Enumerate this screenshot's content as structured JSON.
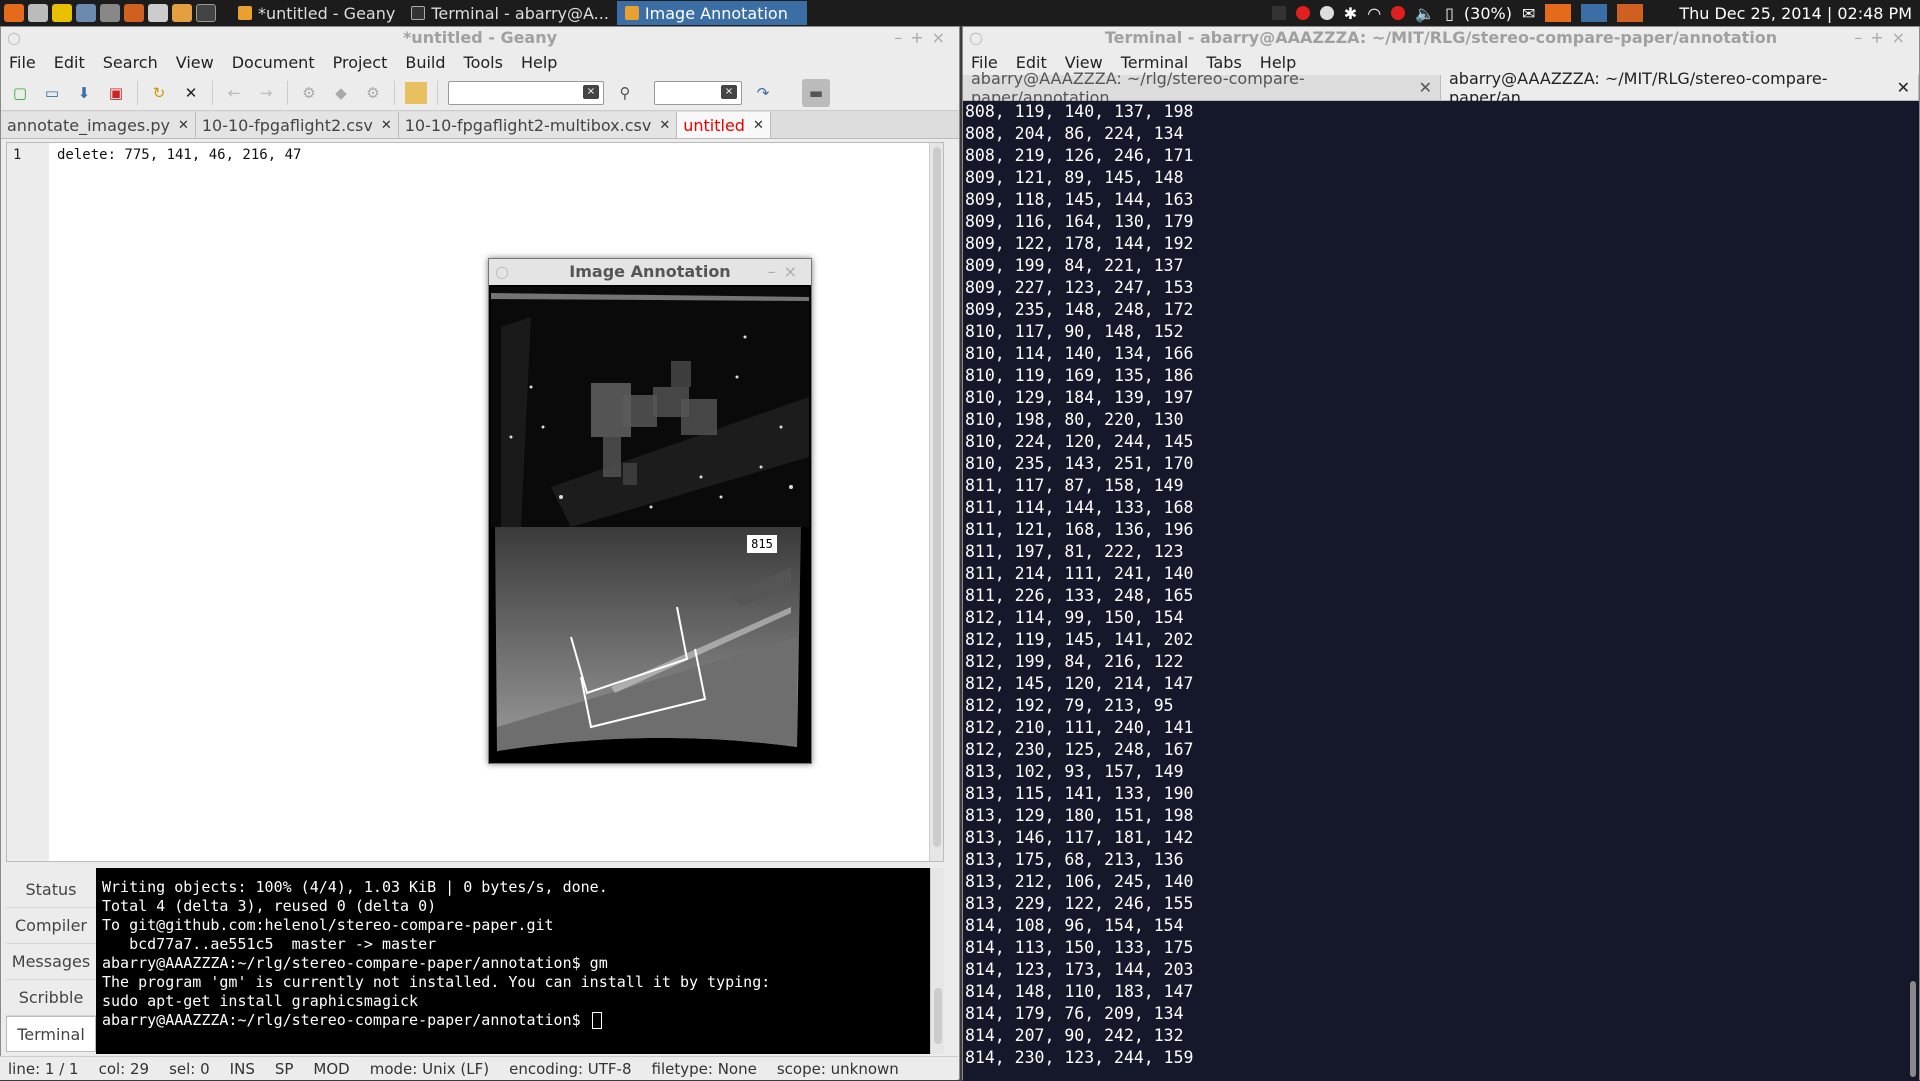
{
  "taskbar": {
    "tasks": [
      {
        "label": "*untitled - Geany"
      },
      {
        "label": "Terminal - abarry@A..."
      },
      {
        "label": "Image Annotation"
      }
    ],
    "battery": "(30%)",
    "clock": "Thu Dec 25, 2014 | 02:48 PM"
  },
  "geany": {
    "title": "*untitled - Geany",
    "menu": [
      "File",
      "Edit",
      "Search",
      "View",
      "Document",
      "Project",
      "Build",
      "Tools",
      "Help"
    ],
    "tabs": [
      {
        "label": "annotate_images.py"
      },
      {
        "label": "10-10-fpgaflight2.csv"
      },
      {
        "label": "10-10-fpgaflight2-multibox.csv"
      },
      {
        "label": "untitled"
      }
    ],
    "editor": {
      "line_number": "1",
      "line_text": "delete: 775, 141, 46, 216, 47"
    },
    "msg_tabs": [
      "Status",
      "Compiler",
      "Messages",
      "Scribble",
      "Terminal"
    ],
    "terminal_lines": [
      "Writing objects: 100% (4/4), 1.03 KiB | 0 bytes/s, done.",
      "Total 4 (delta 3), reused 0 (delta 0)",
      "To git@github.com:helenol/stereo-compare-paper.git",
      "   bcd77a7..ae551c5  master -> master",
      "abarry@AAAZZZA:~/rlg/stereo-compare-paper/annotation$ gm",
      "The program 'gm' is currently not installed. You can install it by typing:",
      "sudo apt-get install graphicsmagick",
      "abarry@AAAZZZA:~/rlg/stereo-compare-paper/annotation$ "
    ],
    "status": {
      "line": "line: 1 / 1",
      "col": "col: 29",
      "sel": "sel: 0",
      "ins": "INS",
      "sp": "SP",
      "mod": "MOD",
      "mode": "mode: Unix (LF)",
      "encoding": "encoding: UTF-8",
      "filetype": "filetype: None",
      "scope": "scope: unknown"
    }
  },
  "annotation": {
    "title": "Image Annotation",
    "frame_label": "815"
  },
  "terminal": {
    "title": "Terminal - abarry@AAAZZZA: ~/MIT/RLG/stereo-compare-paper/annotation",
    "menu": [
      "File",
      "Edit",
      "View",
      "Terminal",
      "Tabs",
      "Help"
    ],
    "tabs": [
      {
        "label": "abarry@AAAZZZA: ~/rlg/stereo-compare-paper/annotation"
      },
      {
        "label": "abarry@AAAZZZA: ~/MIT/RLG/stereo-compare-paper/an..."
      }
    ],
    "lines": [
      "808, 119, 140, 137, 198",
      "808, 204, 86, 224, 134",
      "808, 219, 126, 246, 171",
      "809, 121, 89, 145, 148",
      "809, 118, 145, 144, 163",
      "809, 116, 164, 130, 179",
      "809, 122, 178, 144, 192",
      "809, 199, 84, 221, 137",
      "809, 227, 123, 247, 153",
      "809, 235, 148, 248, 172",
      "810, 117, 90, 148, 152",
      "810, 114, 140, 134, 166",
      "810, 119, 169, 135, 186",
      "810, 129, 184, 139, 197",
      "810, 198, 80, 220, 130",
      "810, 224, 120, 244, 145",
      "810, 235, 143, 251, 170",
      "811, 117, 87, 158, 149",
      "811, 114, 144, 133, 168",
      "811, 121, 168, 136, 196",
      "811, 197, 81, 222, 123",
      "811, 214, 111, 241, 140",
      "811, 226, 133, 248, 165",
      "812, 114, 99, 150, 154",
      "812, 119, 145, 141, 202",
      "812, 199, 84, 216, 122",
      "812, 145, 120, 214, 147",
      "812, 192, 79, 213, 95",
      "812, 210, 111, 240, 141",
      "812, 230, 125, 248, 167",
      "813, 102, 93, 157, 149",
      "813, 115, 141, 133, 190",
      "813, 129, 180, 151, 198",
      "813, 146, 117, 181, 142",
      "813, 175, 68, 213, 136",
      "813, 212, 106, 245, 140",
      "813, 229, 122, 246, 155",
      "814, 108, 96, 154, 154",
      "814, 113, 150, 133, 175",
      "814, 123, 173, 144, 203",
      "814, 148, 110, 183, 147",
      "814, 179, 76, 209, 134",
      "814, 207, 90, 242, 132",
      "814, 230, 123, 244, 159"
    ]
  }
}
